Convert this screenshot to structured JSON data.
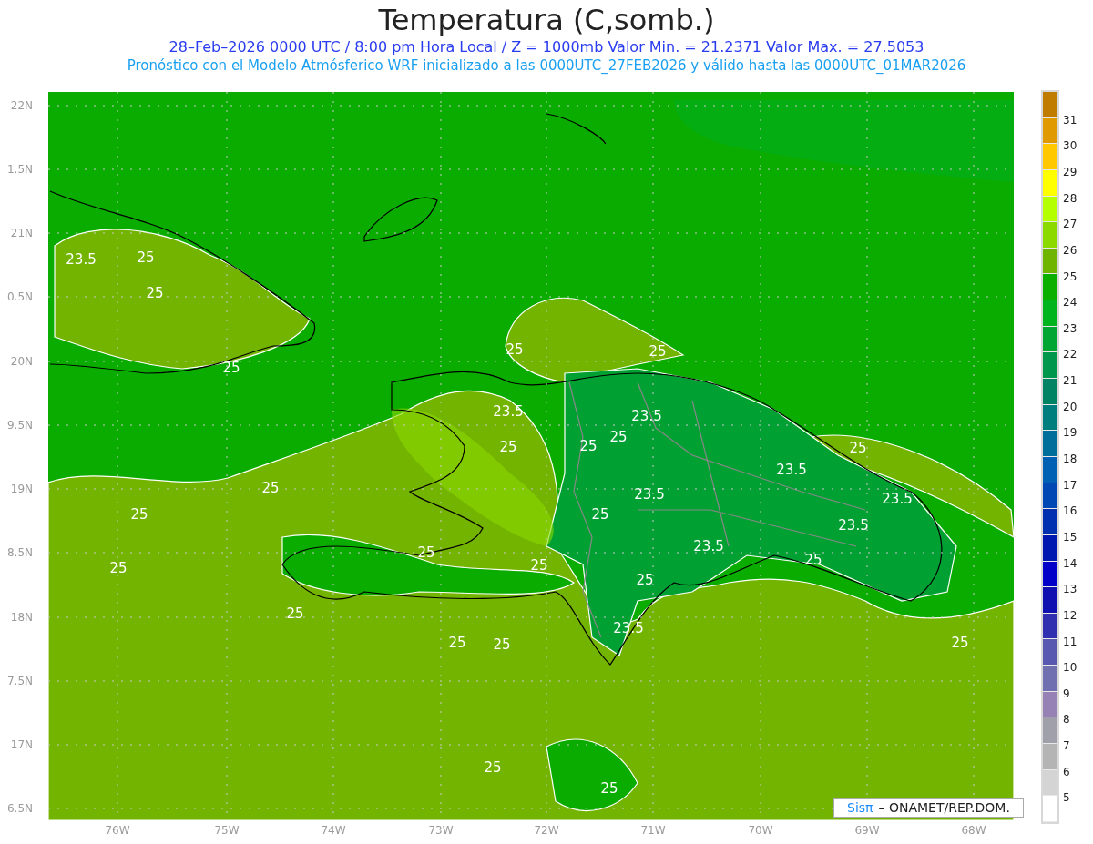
{
  "title": "Temperatura (C,somb.)",
  "subtitle": "28–Feb–2026  0000 UTC / 8:00 pm Hora Local / Z = 1000mb   Valor Min. = 21.2371  Valor Max. = 27.5053",
  "description": "Pronóstico con el Modelo Atmósferico WRF inicializado a las 0000UTC_27FEB2026 y válido hasta las  0000UTC_01MAR2026",
  "map": {
    "lat_labels": [
      "22N",
      "1.5N",
      "21N",
      "0.5N",
      "20N",
      "9.5N",
      "19N",
      "8.5N",
      "18N",
      "7.5N",
      "17N",
      "6.5N"
    ],
    "lon_labels": [
      "76W",
      "75W",
      "74W",
      "73W",
      "72W",
      "71W",
      "70W",
      "69W",
      "68W"
    ],
    "contour_labels": [
      "23.5",
      "25",
      "25",
      "25",
      "25",
      "25",
      "23.5",
      "23.5",
      "25",
      "25",
      "25",
      "25",
      "23.5",
      "25",
      "23.5",
      "25",
      "25",
      "23.5",
      "23.5",
      "23.5",
      "25",
      "25",
      "25",
      "25",
      "25",
      "25",
      "23.5",
      "25",
      "25",
      "25",
      "25",
      "25"
    ],
    "credit": {
      "brand": "Sisπ",
      "text": "– ONAMET/REP.DOM."
    }
  },
  "colorbar": {
    "labels": [
      "31",
      "30",
      "29",
      "28",
      "27",
      "26",
      "25",
      "24",
      "23",
      "22",
      "21",
      "20",
      "19",
      "18",
      "17",
      "16",
      "15",
      "14",
      "13",
      "12",
      "11",
      "10",
      "9",
      "8",
      "7",
      "6",
      "5"
    ],
    "segments": [
      {
        "color": "#c07c00"
      },
      {
        "color": "#e09a00"
      },
      {
        "color": "#ffc800"
      },
      {
        "color": "#ffff00"
      },
      {
        "color": "#b4ff00"
      },
      {
        "color": "#8cd900"
      },
      {
        "color": "#6eb400"
      },
      {
        "color": "#0aaf00"
      },
      {
        "color": "#00b41e"
      },
      {
        "color": "#00a532"
      },
      {
        "color": "#00964b"
      },
      {
        "color": "#008264"
      },
      {
        "color": "#007d7d"
      },
      {
        "color": "#006e9b"
      },
      {
        "color": "#0060b4"
      },
      {
        "color": "#0048b4"
      },
      {
        "color": "#0030b0"
      },
      {
        "color": "#0018b0"
      },
      {
        "color": "#0000c8"
      },
      {
        "color": "#1010b0"
      },
      {
        "color": "#3030b0"
      },
      {
        "color": "#5858b0"
      },
      {
        "color": "#7070b0"
      },
      {
        "color": "#9682b4"
      },
      {
        "color": "#a0a0aa"
      },
      {
        "color": "#b4b4b4"
      },
      {
        "color": "#d4d4d4"
      },
      {
        "color": "#ffffff"
      }
    ]
  }
}
